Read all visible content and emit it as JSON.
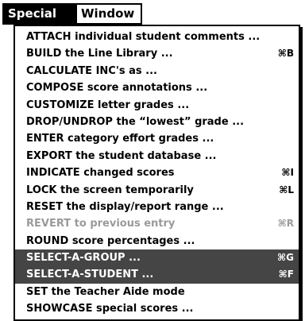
{
  "menubar": {
    "special_label": "Special",
    "window_label": "Window"
  },
  "menu": {
    "items": [
      {
        "label": "ATTACH individual student comments ...",
        "shortcut": "",
        "state": "normal"
      },
      {
        "label": "BUILD the Line Library ...",
        "shortcut": "⌘B",
        "state": "normal"
      },
      {
        "label": "CALCULATE INC's as ...",
        "shortcut": "",
        "state": "normal"
      },
      {
        "label": "COMPOSE score annotations ...",
        "shortcut": "",
        "state": "normal"
      },
      {
        "label": "CUSTOMIZE letter grades ...",
        "shortcut": "",
        "state": "normal"
      },
      {
        "label": "DROP/UNDROP the “lowest” grade ...",
        "shortcut": "",
        "state": "normal"
      },
      {
        "label": "ENTER category effort grades ...",
        "shortcut": "",
        "state": "normal"
      },
      {
        "label": "EXPORT the student database ...",
        "shortcut": "",
        "state": "normal"
      },
      {
        "label": "INDICATE changed scores",
        "shortcut": "⌘I",
        "state": "normal"
      },
      {
        "label": "LOCK the screen temporarily",
        "shortcut": "⌘L",
        "state": "normal"
      },
      {
        "label": "RESET the display/report range ...",
        "shortcut": "",
        "state": "normal"
      },
      {
        "label": "REVERT to previous entry",
        "shortcut": "⌘R",
        "state": "disabled"
      },
      {
        "label": "ROUND score percentages ...",
        "shortcut": "",
        "state": "normal"
      },
      {
        "label": "SELECT-A-GROUP ...",
        "shortcut": "⌘G",
        "state": "highlighted"
      },
      {
        "label": "SELECT-A-STUDENT ...",
        "shortcut": "⌘F",
        "state": "highlighted"
      },
      {
        "label": "SET the Teacher Aide mode",
        "shortcut": "",
        "state": "normal"
      },
      {
        "label": "SHOWCASE special scores ...",
        "shortcut": "",
        "state": "normal"
      }
    ]
  }
}
